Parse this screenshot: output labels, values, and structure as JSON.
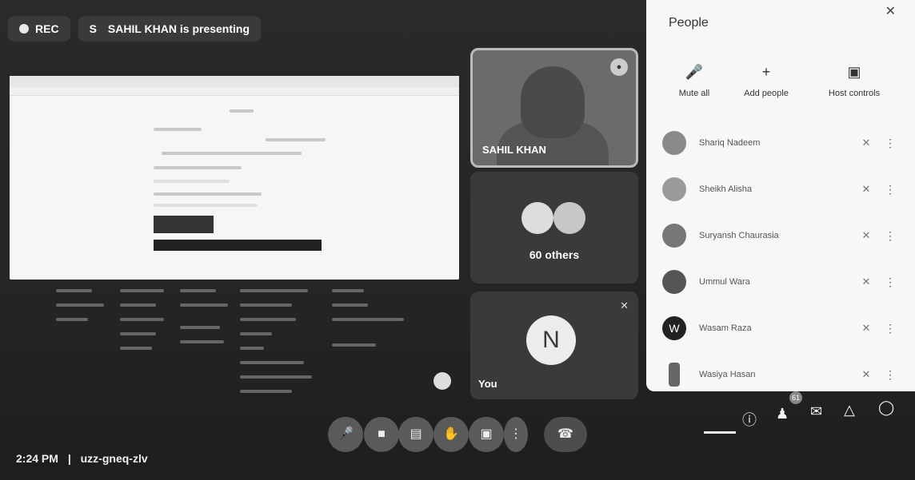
{
  "topbar": {
    "rec_label": "REC",
    "presenter_initial": "S",
    "presenting_text": "SAHIL KHAN is presenting"
  },
  "tiles": {
    "presenter_name": "SAHIL KHAN",
    "others_label": "60 others",
    "self_initial": "N",
    "self_label": "You"
  },
  "people_panel": {
    "title": "People",
    "actions": [
      {
        "label": "Mute all",
        "icon": "mic-off-icon"
      },
      {
        "label": "Add people",
        "icon": "add-person-icon"
      },
      {
        "label": "Host controls",
        "icon": "host-controls-icon"
      }
    ],
    "participants": [
      {
        "name": "Shariq Nadeem",
        "initial": ""
      },
      {
        "name": "Sheikh Alisha",
        "initial": ""
      },
      {
        "name": "Suryansh Chaurasia",
        "initial": ""
      },
      {
        "name": "Ummul Wara",
        "initial": ""
      },
      {
        "name": "Wasam Raza",
        "initial": "W"
      },
      {
        "name": "Wasiya Hasan",
        "initial": ""
      }
    ]
  },
  "bottombar": {
    "time": "2:24 PM",
    "meeting_code": "uzz-gneq-zlv",
    "participant_count": "61"
  }
}
